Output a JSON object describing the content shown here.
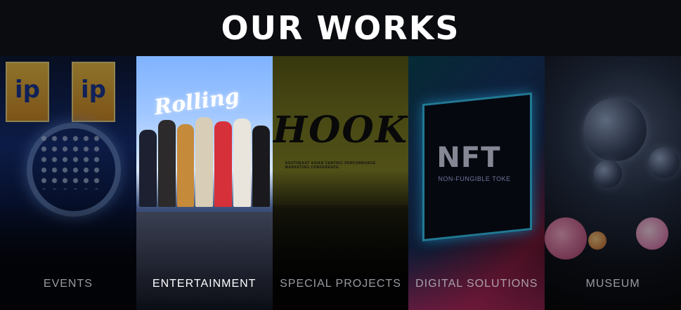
{
  "header": {
    "title": "OUR WORKS"
  },
  "panels": [
    {
      "label": "EVENTS",
      "active": false
    },
    {
      "label": "ENTERTAINMENT",
      "active": true
    },
    {
      "label": "SPECIAL PROJECTS",
      "active": false
    },
    {
      "label": "DIGITAL SOLUTIONS",
      "active": false
    },
    {
      "label": "MUSEUM",
      "active": false
    }
  ],
  "artwork": {
    "events_board": "ip",
    "entertainment_logo": "Rolling",
    "special_logo": "HOOK",
    "special_tagline": "SOUTHEAST ASIAN CENTRIC PERFORMANCE MARKETING CONFERENCE",
    "digital_title": "NFT",
    "digital_subtitle": "NON-FUNGIBLE TOKE"
  }
}
